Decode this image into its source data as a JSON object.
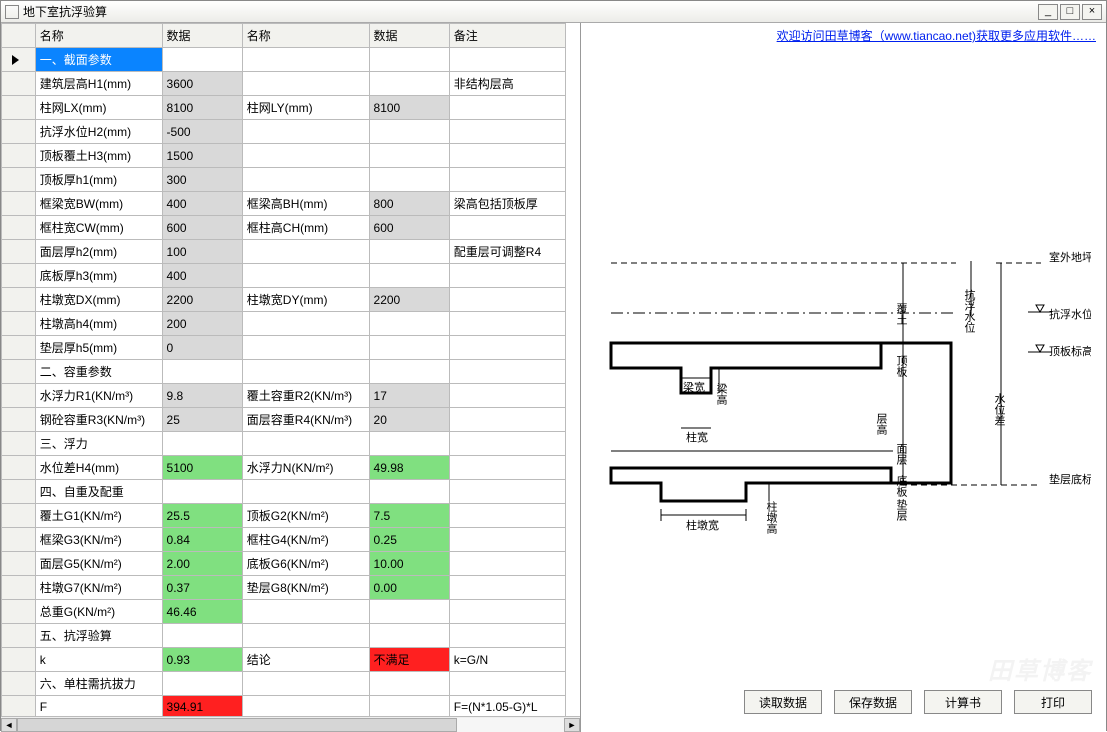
{
  "window": {
    "title": "地下室抗浮验算",
    "minimize": "_",
    "maximize": "□",
    "close": "×"
  },
  "link": {
    "text": "欢迎访问田草博客（www.tiancao.net)获取更多应用软件……"
  },
  "columns": {
    "name1": "名称",
    "data1": "数据",
    "name2": "名称",
    "data2": "数据",
    "note": "备注"
  },
  "rows": [
    {
      "section": true,
      "n1": "一、截面参数"
    },
    {
      "n1": "建筑层高H1(mm)",
      "d1": "3600",
      "d1c": "gray",
      "note": "非结构层高"
    },
    {
      "n1": "柱网LX(mm)",
      "d1": "8100",
      "d1c": "gray",
      "n2": "柱网LY(mm)",
      "d2": "8100",
      "d2c": "gray"
    },
    {
      "n1": "抗浮水位H2(mm)",
      "d1": "-500",
      "d1c": "gray"
    },
    {
      "n1": "顶板覆土H3(mm)",
      "d1": "1500",
      "d1c": "gray"
    },
    {
      "n1": "顶板厚h1(mm)",
      "d1": "300",
      "d1c": "gray"
    },
    {
      "n1": "框梁宽BW(mm)",
      "d1": "400",
      "d1c": "gray",
      "n2": "框梁高BH(mm)",
      "d2": "800",
      "d2c": "gray",
      "note": "梁高包括顶板厚"
    },
    {
      "n1": "框柱宽CW(mm)",
      "d1": "600",
      "d1c": "gray",
      "n2": "框柱高CH(mm)",
      "d2": "600",
      "d2c": "gray"
    },
    {
      "n1": "面层厚h2(mm)",
      "d1": "100",
      "d1c": "gray",
      "note": "配重层可调整R4"
    },
    {
      "n1": "底板厚h3(mm)",
      "d1": "400",
      "d1c": "gray"
    },
    {
      "n1": "柱墩宽DX(mm)",
      "d1": "2200",
      "d1c": "gray",
      "n2": "柱墩宽DY(mm)",
      "d2": "2200",
      "d2c": "gray"
    },
    {
      "n1": "柱墩高h4(mm)",
      "d1": "200",
      "d1c": "gray"
    },
    {
      "n1": "垫层厚h5(mm)",
      "d1": "0",
      "d1c": "gray"
    },
    {
      "section": true,
      "n1": "二、容重参数"
    },
    {
      "n1": "水浮力R1(KN/m³)",
      "d1": "9.8",
      "d1c": "gray",
      "n2": "覆土容重R2(KN/m³)",
      "d2": "17",
      "d2c": "gray"
    },
    {
      "n1": "钢砼容重R3(KN/m³)",
      "d1": "25",
      "d1c": "gray",
      "n2": "面层容重R4(KN/m³)",
      "d2": "20",
      "d2c": "gray"
    },
    {
      "section": true,
      "n1": "三、浮力"
    },
    {
      "n1": "水位差H4(mm)",
      "d1": "5100",
      "d1c": "green",
      "n2": "水浮力N(KN/m²)",
      "d2": "49.98",
      "d2c": "green"
    },
    {
      "section": true,
      "n1": "四、自重及配重"
    },
    {
      "n1": "覆土G1(KN/m²)",
      "d1": "25.5",
      "d1c": "green",
      "n2": "顶板G2(KN/m²)",
      "d2": "7.5",
      "d2c": "green"
    },
    {
      "n1": "框梁G3(KN/m²)",
      "d1": "0.84",
      "d1c": "green",
      "n2": "框柱G4(KN/m²)",
      "d2": "0.25",
      "d2c": "green"
    },
    {
      "n1": "面层G5(KN/m²)",
      "d1": "2.00",
      "d1c": "green",
      "n2": "底板G6(KN/m²)",
      "d2": "10.00",
      "d2c": "green"
    },
    {
      "n1": "柱墩G7(KN/m²)",
      "d1": "0.37",
      "d1c": "green",
      "n2": "垫层G8(KN/m²)",
      "d2": "0.00",
      "d2c": "green"
    },
    {
      "n1": "总重G(KN/m²)",
      "d1": "46.46",
      "d1c": "green"
    },
    {
      "section": true,
      "n1": "五、抗浮验算"
    },
    {
      "n1": "k",
      "d1": "0.93",
      "d1c": "green",
      "n2": "结论",
      "d2": "不满足",
      "d2c": "red",
      "note": "k=G/N"
    },
    {
      "section": true,
      "n1": "六、单柱需抗拔力"
    },
    {
      "n1": "F",
      "d1": "394.91",
      "d1c": "red",
      "note": "F=(N*1.05-G)*L"
    }
  ],
  "diagram": {
    "labels": {
      "outdoor": "室外地坪",
      "floatLevel": "抗浮水位",
      "topSlab": "顶板标高",
      "bedBottom": "垫层底标高",
      "cover": "覆土",
      "topSlabV": "顶板",
      "layer": "层高",
      "surface": "面层",
      "bottomSlab": "底板",
      "bed": "垫层",
      "beamW": "梁宽",
      "beamH": "梁高",
      "colW": "柱宽",
      "pierW": "柱墩宽",
      "pierH": "柱墩高",
      "waterDiff": "水位差",
      "floatAxis": "抗浮水位"
    }
  },
  "buttons": {
    "load": "读取数据",
    "save": "保存数据",
    "report": "计算书",
    "print": "打印"
  },
  "watermark": "田草博客"
}
